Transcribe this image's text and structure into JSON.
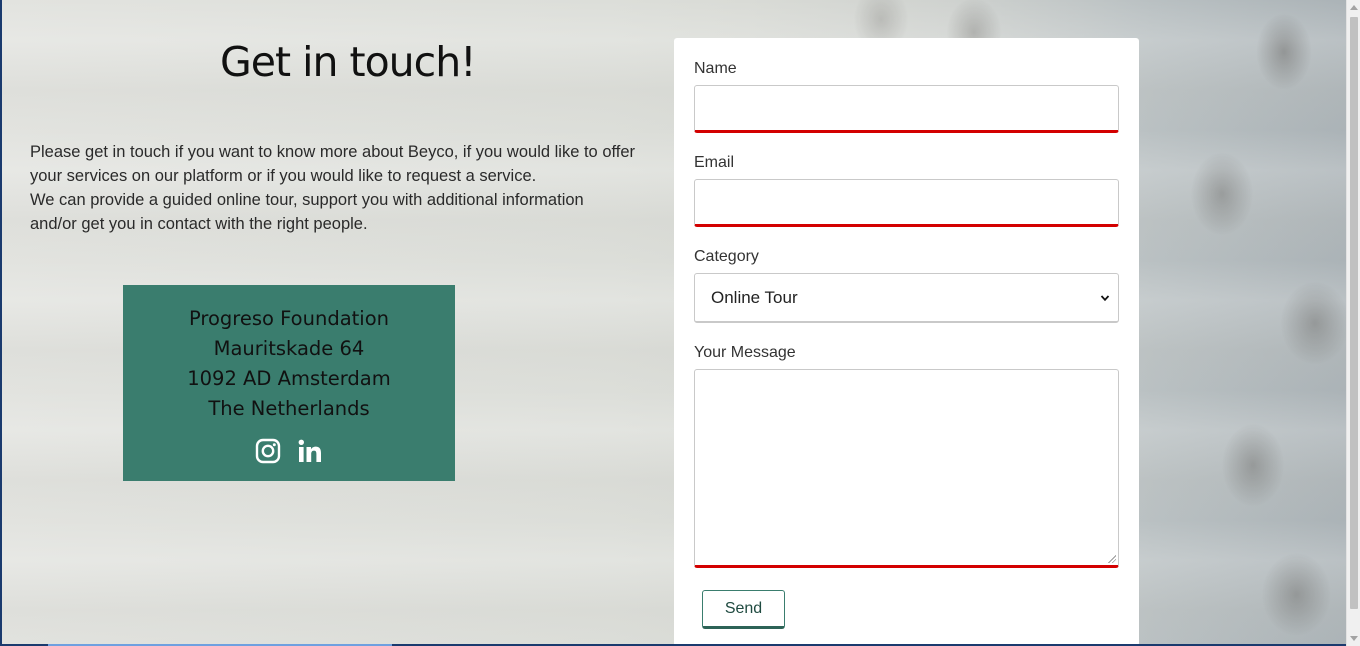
{
  "page": {
    "title": "Get in touch!",
    "intro_lines": [
      "Please get in touch if you want to know more about Beyco, if you would like to offer",
      "your services on our platform or if you would like to request a service.",
      "We can provide a guided online tour, support you with additional information",
      "and/or get you in contact with the right people."
    ]
  },
  "address": {
    "lines": [
      "Progreso Foundation",
      "Mauritskade 64",
      "1092 AD Amsterdam",
      "The Netherlands"
    ],
    "socials": [
      "instagram-icon",
      "linkedin-icon"
    ]
  },
  "form": {
    "name_label": "Name",
    "name_value": "",
    "email_label": "Email",
    "email_value": "",
    "category_label": "Category",
    "category_value": "Online Tour",
    "message_label": "Your Message",
    "message_value": "",
    "send_label": "Send"
  },
  "colors": {
    "address_bg": "#3a7d6e",
    "invalid_border": "#d30000",
    "button_accent": "#3a7d6e"
  }
}
